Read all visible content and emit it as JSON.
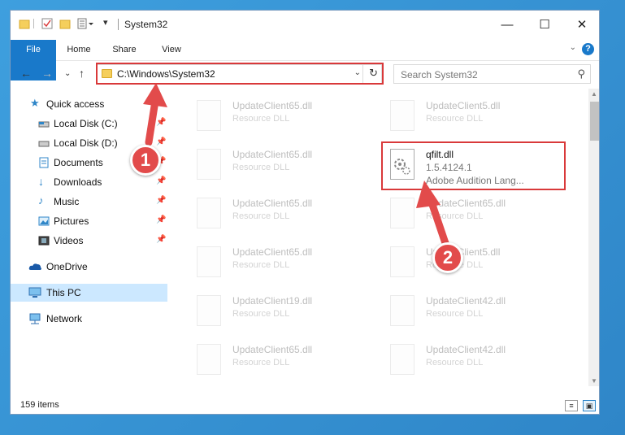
{
  "window": {
    "title": "System32"
  },
  "ribbon": {
    "tabs": [
      "File",
      "Home",
      "Share",
      "View"
    ],
    "help": "?"
  },
  "address": {
    "path": "C:\\Windows\\System32"
  },
  "search": {
    "placeholder": "Search System32"
  },
  "sidebar": {
    "items": [
      {
        "label": "Quick access",
        "icon": "star-icon"
      },
      {
        "label": "Local Disk (C:)",
        "icon": "drive-icon",
        "pinned": true
      },
      {
        "label": "Local Disk (D:)",
        "icon": "drive-icon",
        "pinned": true
      },
      {
        "label": "Documents",
        "icon": "documents-icon",
        "pinned": true
      },
      {
        "label": "Downloads",
        "icon": "download-icon",
        "pinned": true
      },
      {
        "label": "Music",
        "icon": "music-icon",
        "pinned": true
      },
      {
        "label": "Pictures",
        "icon": "pictures-icon",
        "pinned": true
      },
      {
        "label": "Videos",
        "icon": "videos-icon",
        "pinned": true
      },
      {
        "label": "OneDrive",
        "icon": "cloud-icon"
      },
      {
        "label": "This PC",
        "icon": "computer-icon",
        "selected": true
      },
      {
        "label": "Network",
        "icon": "network-icon"
      }
    ]
  },
  "files": {
    "left": [
      {
        "name": "UpdateClient65.dll",
        "desc": "Resource DLL"
      },
      {
        "name": "UpdateClient65.dll",
        "desc": "Resource DLL"
      },
      {
        "name": "UpdateClient65.dll",
        "desc": "Resource DLL"
      },
      {
        "name": "UpdateClient65.dll",
        "desc": "Resource DLL"
      },
      {
        "name": "UpdateClient19.dll",
        "desc": "Resource DLL"
      },
      {
        "name": "UpdateClient65.dll",
        "desc": "Resource DLL"
      }
    ],
    "right": [
      {
        "name": "UpdateClient5.dll",
        "desc": "Resource DLL"
      },
      {
        "name": "UpdateClient65.dll",
        "desc": "Resource DLL"
      },
      {
        "name": "UpdateClient5.dll",
        "desc": "Resource DLL"
      },
      {
        "name": "UpdateClient42.dll",
        "desc": "Resource DLL"
      },
      {
        "name": "UpdateClient42.dll",
        "desc": "Resource DLL"
      }
    ],
    "featured": {
      "name": "qfilt.dll",
      "version": "1.5.4124.1",
      "desc": "Adobe Audition Lang..."
    }
  },
  "status": {
    "items": "159 items"
  },
  "badges": [
    "1",
    "2"
  ],
  "colors": {
    "accent": "#1979ca",
    "highlight": "#d9393a",
    "badge": "#e24b4b"
  }
}
